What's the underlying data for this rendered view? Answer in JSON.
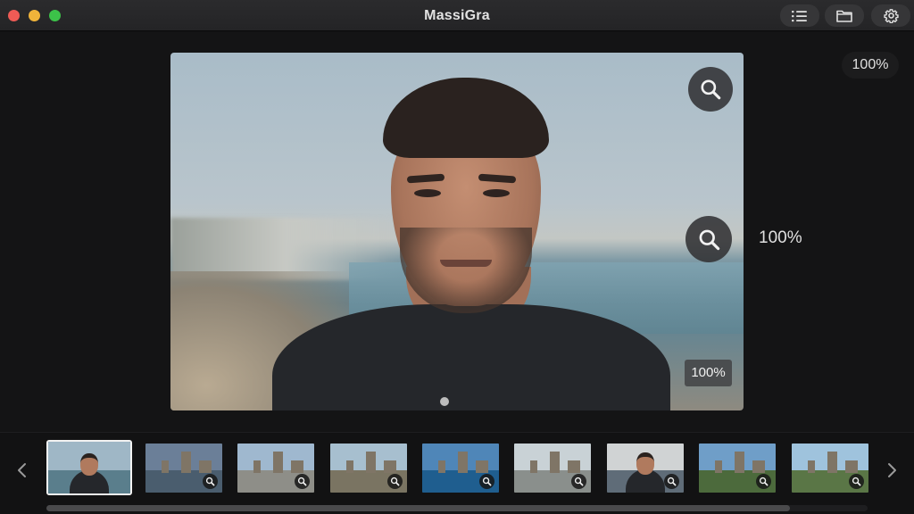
{
  "window": {
    "title": "MassiGra",
    "toolbar_icons": [
      "list-icon",
      "folder-icon",
      "gear-icon"
    ]
  },
  "viewer": {
    "zoom_badge_corner": "100%",
    "zoom_text_mid": "100%",
    "zoom_badge_photo": "100%",
    "zoom_icons": [
      "magnifier-icon",
      "magnifier-icon"
    ]
  },
  "filmstrip": {
    "selected_index": 0,
    "thumbnails": [
      {
        "subject": "portrait-beach",
        "sky": "#9fb7c6",
        "ground": "#5a7e8c",
        "zoom_icon": false
      },
      {
        "subject": "city-sunset",
        "sky": "#6b7f98",
        "ground": "#4a5d6e",
        "zoom_icon": true
      },
      {
        "subject": "ruins-plaza",
        "sky": "#9fb8cf",
        "ground": "#8e8e88",
        "zoom_icon": true
      },
      {
        "subject": "stone-ruins",
        "sky": "#a7bfcf",
        "ground": "#7a7462",
        "zoom_icon": true
      },
      {
        "subject": "pool-palace",
        "sky": "#4f86b8",
        "ground": "#1f5e8f",
        "zoom_icon": true
      },
      {
        "subject": "modern-building",
        "sky": "#c9d2d6",
        "ground": "#8a8f8c",
        "zoom_icon": true
      },
      {
        "subject": "selfie-traveler",
        "sky": "#d0d3d4",
        "ground": "#5f6c78",
        "zoom_icon": true
      },
      {
        "subject": "ruins-field",
        "sky": "#6f9ec8",
        "ground": "#4c6a3c",
        "zoom_icon": true
      },
      {
        "subject": "city-field",
        "sky": "#9fc3dd",
        "ground": "#5a7646",
        "zoom_icon": true
      }
    ],
    "nav_icons": [
      "chevron-left-icon",
      "chevron-right-icon"
    ]
  }
}
